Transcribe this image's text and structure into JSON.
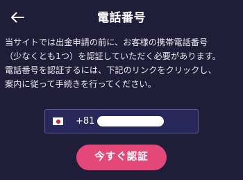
{
  "header": {
    "back_icon": "arrow-left-icon",
    "title": "電話番号"
  },
  "description": {
    "lines": [
      "当サイトでは出金申請の前に、お客様の携帯電話番号",
      "（少なくとも1つ）を認証していただく必要があります。",
      "電話番号を認証するには、下記のリンクをクリックし、",
      "案内に従って手続きを行ってください。"
    ]
  },
  "phone_field": {
    "flag_icon": "japan-flag-icon",
    "dial_code": "+81"
  },
  "verify_button": {
    "label": "今すぐ認証"
  },
  "colors": {
    "background": "#201d38",
    "field_background": "#28275a",
    "field_border": "#5b5a9c",
    "accent": "#e4477a"
  }
}
